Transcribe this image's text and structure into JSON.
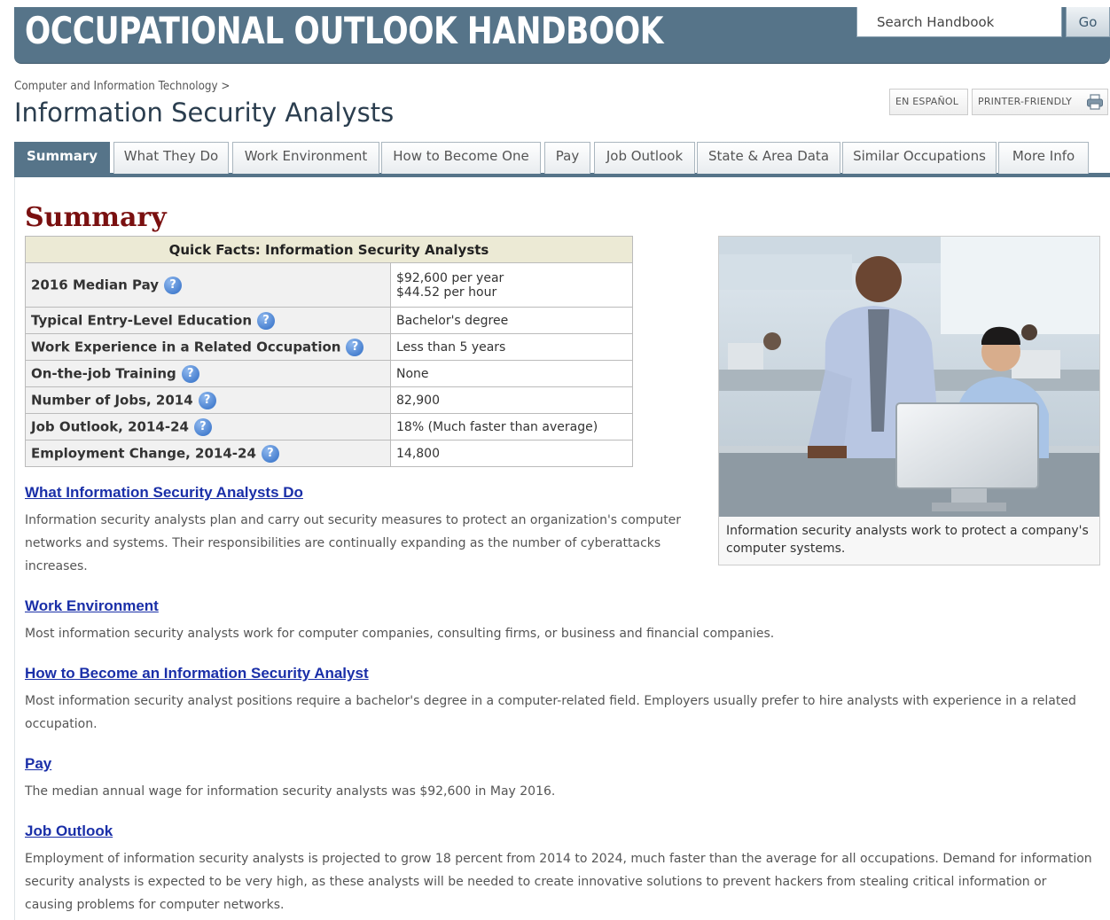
{
  "banner": {
    "title": "OCCUPATIONAL OUTLOOK HANDBOOK",
    "search_placeholder": "Search Handbook",
    "go_label": "Go",
    "color": "#567489"
  },
  "header": {
    "breadcrumb": "Computer and Information Technology >",
    "title": "Information Security Analysts",
    "espanol_label": "EN ESPAÑOL",
    "printer_label": "PRINTER-FRIENDLY"
  },
  "tabs": [
    {
      "label": "Summary",
      "active": true
    },
    {
      "label": "What They Do"
    },
    {
      "label": "Work Environment"
    },
    {
      "label": "How to Become One"
    },
    {
      "label": "Pay"
    },
    {
      "label": "Job Outlook"
    },
    {
      "label": "State & Area Data"
    },
    {
      "label": "Similar Occupations"
    },
    {
      "label": "More Info"
    }
  ],
  "summary": {
    "heading": "Summary",
    "quick_facts": {
      "title": "Quick Facts: Information Security Analysts",
      "rows": [
        {
          "label": "2016 Median Pay",
          "value1": "$92,600 per year",
          "value2": "$44.52 per hour"
        },
        {
          "label": "Typical Entry-Level Education",
          "value1": "Bachelor's degree"
        },
        {
          "label": "Work Experience in a Related Occupation",
          "value1": "Less than 5 years"
        },
        {
          "label": "On-the-job Training",
          "value1": "None"
        },
        {
          "label": "Number of Jobs, 2014",
          "value1": "82,900"
        },
        {
          "label": "Job Outlook, 2014-24",
          "value1": "18% (Much faster than average)"
        },
        {
          "label": "Employment Change, 2014-24",
          "value1": "14,800"
        }
      ],
      "info_icon": "?"
    },
    "figure": {
      "caption": "Information security analysts work to protect a company's computer systems."
    }
  },
  "sections": [
    {
      "title": "What Information Security Analysts Do",
      "text": "Information security analysts plan and carry out security measures to protect an organization's computer networks and systems. Their responsibilities are continually expanding as the number of cyberattacks increases."
    },
    {
      "title": "Work Environment",
      "text": "Most information security analysts work for computer companies, consulting firms, or business and financial companies."
    },
    {
      "title": "How to Become an Information Security Analyst",
      "text": "Most information security analyst positions require a bachelor's degree in a computer-related field. Employers usually prefer to hire analysts with experience in a related occupation."
    },
    {
      "title": "Pay",
      "text": "The median annual wage for information security analysts was $92,600 in May 2016."
    },
    {
      "title": "Job Outlook",
      "text": "Employment of information security analysts is projected to grow 18 percent from 2014 to 2024, much faster than the average for all occupations. Demand for information security analysts is expected to be very high, as these analysts will be needed to create innovative solutions to prevent hackers from stealing critical information or causing problems for computer networks."
    }
  ]
}
